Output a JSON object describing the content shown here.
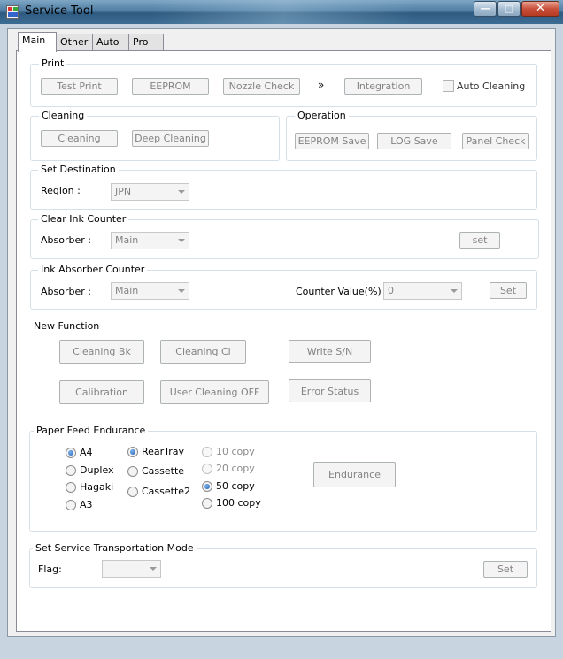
{
  "window": {
    "title": "Service Tool",
    "minimize": "—",
    "maximize": "□",
    "close": "✕"
  },
  "tabs": [
    "Main",
    "Other",
    "Auto",
    "Pro"
  ],
  "print": {
    "legend": "Print",
    "test_print": "Test Print",
    "eeprom": "EEPROM",
    "nozzle_check": "Nozzle Check",
    "arrow": "»",
    "integration": "Integration",
    "auto_cleaning": "Auto Cleaning"
  },
  "cleaning": {
    "legend": "Cleaning",
    "cleaning": "Cleaning",
    "deep_cleaning": "Deep Cleaning"
  },
  "operation": {
    "legend": "Operation",
    "eeprom_save": "EEPROM Save",
    "log_save": "LOG Save",
    "panel_check": "Panel Check"
  },
  "set_destination": {
    "legend": "Set Destination",
    "region_label": "Region :",
    "region_value": "JPN"
  },
  "clear_ink_counter": {
    "legend": "Clear Ink Counter",
    "absorber_label": "Absorber :",
    "absorber_value": "Main",
    "set": "set"
  },
  "ink_absorber_counter": {
    "legend": "Ink Absorber Counter",
    "absorber_label": "Absorber :",
    "absorber_value": "Main",
    "counter_label": "Counter Value(%) :",
    "counter_value": "0",
    "set": "Set"
  },
  "new_function": {
    "label": "New Function",
    "cleaning_bk": "Cleaning Bk",
    "cleaning_cl": "Cleaning Cl",
    "write_sn": "Write S/N",
    "calibration": "Calibration",
    "user_cleaning_off": "User Cleaning OFF",
    "error_status": "Error Status"
  },
  "paper_feed": {
    "legend": "Paper Feed Endurance",
    "sizes": [
      "A4",
      "Duplex",
      "Hagaki",
      "A3"
    ],
    "sources": [
      "RearTray",
      "Cassette",
      "Cassette2"
    ],
    "copies": [
      "10 copy",
      "20 copy",
      "50 copy",
      "100 copy"
    ],
    "selected_size": "A4",
    "selected_source": "RearTray",
    "selected_copies": "50 copy",
    "endurance": "Endurance"
  },
  "transport_mode": {
    "legend": "Set Service Transportation Mode",
    "flag_label": "Flag:",
    "flag_value": "",
    "set": "Set"
  }
}
